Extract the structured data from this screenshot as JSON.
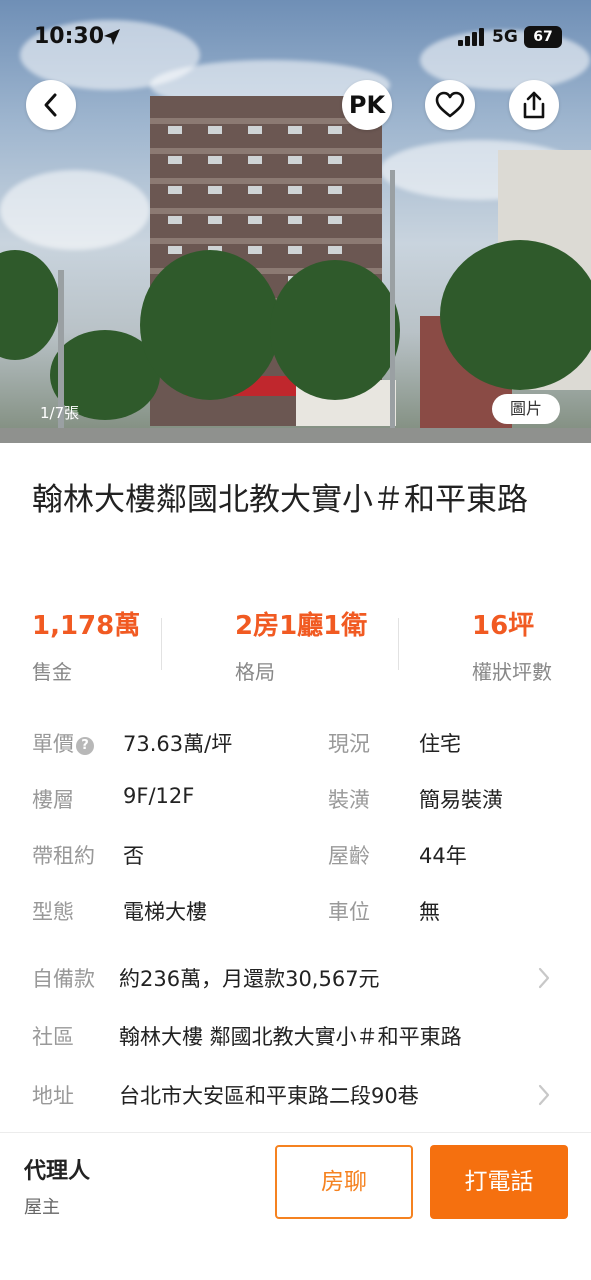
{
  "status_bar": {
    "time": "10:30",
    "network": "5G",
    "battery": "67"
  },
  "top_actions": {
    "compare_label": "PK"
  },
  "gallery": {
    "counter": "1/7張",
    "tag": "圖片"
  },
  "listing": {
    "title": "翰林大樓鄰國北教大實小＃和平東路",
    "price": {
      "value": "1,178萬",
      "label": "售金"
    },
    "layout": {
      "value": "2房1廳1衛",
      "label": "格局"
    },
    "area": {
      "value": "16坪",
      "label": "權狀坪數"
    }
  },
  "details": {
    "unit_price": {
      "label": "單價",
      "value": "73.63萬/坪"
    },
    "status": {
      "label": "現況",
      "value": "住宅"
    },
    "floor": {
      "label": "樓層",
      "value": "9F/12F"
    },
    "decoration": {
      "label": "裝潢",
      "value": "簡易裝潢"
    },
    "lease": {
      "label": "帶租約",
      "value": "否"
    },
    "age": {
      "label": "屋齡",
      "value": "44年"
    },
    "type": {
      "label": "型態",
      "value": "電梯大樓"
    },
    "parking": {
      "label": "車位",
      "value": "無"
    },
    "down_payment": {
      "label": "自備款",
      "value": "約236萬，月還款30,567元"
    },
    "community": {
      "label": "社區",
      "value": "翰林大樓 鄰國北教大實小＃和平東路"
    },
    "address": {
      "label": "地址",
      "value": "台北市大安區和平東路二段90巷"
    }
  },
  "bottom_bar": {
    "agent_title": "代理人",
    "agent_role": "屋主",
    "chat_button": "房聊",
    "call_button": "打電話"
  },
  "colors": {
    "accent": "#f15a22",
    "call_button": "#f5700f",
    "label_gray": "#999999"
  }
}
